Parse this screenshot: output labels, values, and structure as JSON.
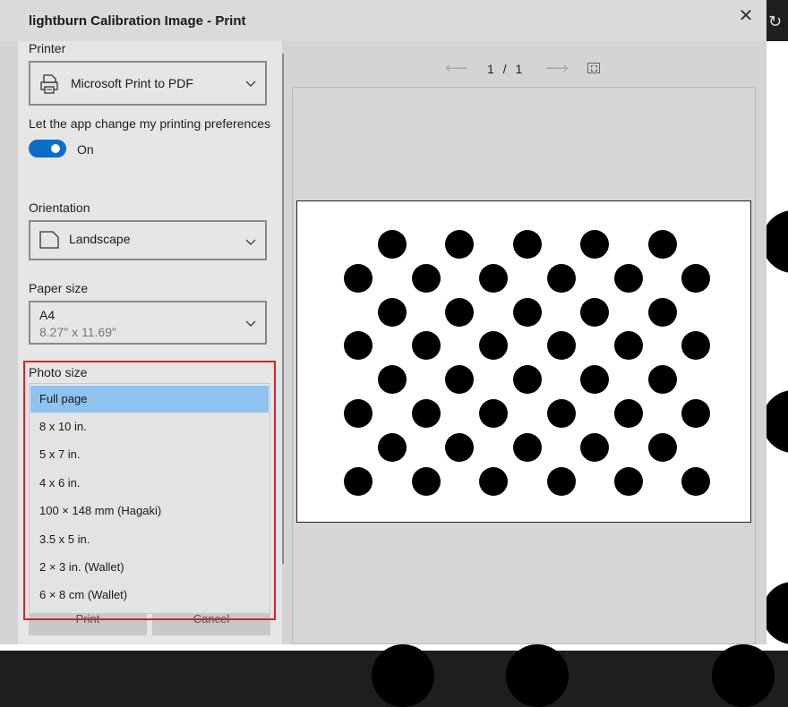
{
  "window": {
    "title": "lightburn Calibration Image - Print",
    "close_label": "✕"
  },
  "printer": {
    "label": "Printer",
    "value": "Microsoft Print to PDF"
  },
  "preferences": {
    "label": "Let the app change my printing preferences",
    "toggle_state": "On",
    "toggle_on": true
  },
  "orientation": {
    "label": "Orientation",
    "value": "Landscape"
  },
  "paper_size": {
    "label": "Paper size",
    "value": "A4",
    "dimensions": "8.27\" x 11.69\""
  },
  "photo_size": {
    "label": "Photo size",
    "selected": "Full page",
    "options": [
      "Full page",
      "8 x 10 in.",
      "5 x 7 in.",
      "4 x 6 in.",
      "100 × 148 mm (Hagaki)",
      "3.5 x 5 in.",
      "2 × 3 in. (Wallet)",
      "6 × 8 cm (Wallet)"
    ]
  },
  "footer": {
    "print_label": "Print",
    "cancel_label": "Cancel"
  },
  "preview": {
    "current_page": "1",
    "separator": "/",
    "total_pages": "1",
    "prev_icon": "arrow-left-icon",
    "next_icon": "arrow-right-icon",
    "fit_icon": "fit-to-window-icon",
    "pattern": {
      "type": "asymmetric circle grid",
      "rows": 8,
      "columns_per_row": [
        5,
        6,
        5,
        6,
        5,
        6,
        5,
        6
      ]
    }
  },
  "colors": {
    "accent": "#0a6ec9",
    "selection": "#8ec3ef",
    "highlight_border": "#e02020"
  }
}
